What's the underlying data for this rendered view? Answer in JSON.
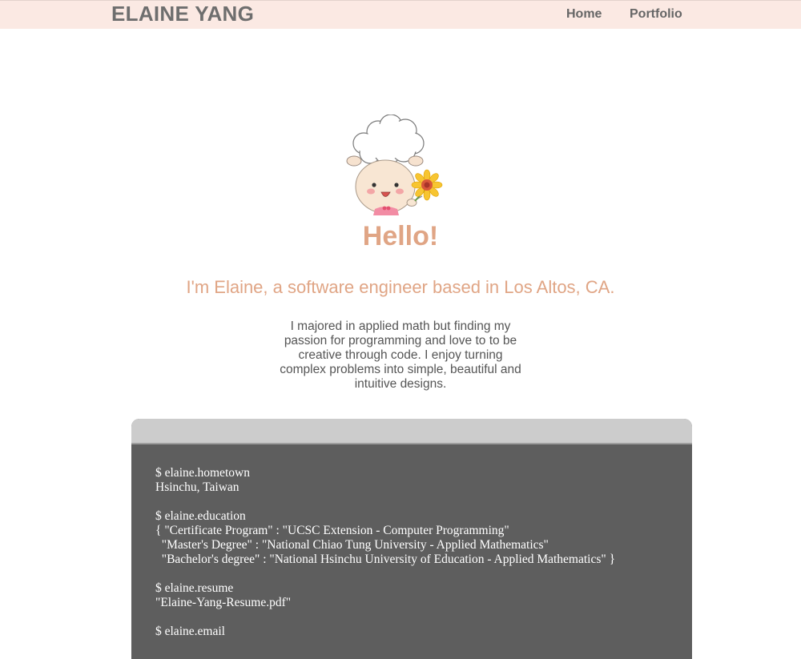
{
  "nav": {
    "brand": "ELAINE YANG",
    "links": [
      {
        "label": "Home"
      },
      {
        "label": "Portfolio"
      }
    ]
  },
  "hero": {
    "greeting": "Hello!",
    "tagline": "I'm Elaine, a software engineer based in Los Altos, CA.",
    "bio": "I majored in applied math but finding my passion for programming and love to to be creative through code. I enjoy turning complex problems into simple, beautiful and intuitive designs."
  },
  "terminal": {
    "blocks": [
      {
        "command": "$ elaine.hometown",
        "output": [
          "Hsinchu, Taiwan"
        ]
      },
      {
        "command": "$ elaine.education",
        "output": [
          "{ \"Certificate Program\" : \"UCSC Extension - Computer Programming\"",
          "  \"Master's Degree\" : \"National Chiao Tung University - Applied Mathematics\"",
          "  \"Bachelor's degree\" : \"National Hsinchu University of Education - Applied Mathematics\" }"
        ]
      },
      {
        "command": "$ elaine.resume",
        "output": [
          "\"Elaine-Yang-Resume.pdf\""
        ]
      },
      {
        "command": "$ elaine.email",
        "output": []
      }
    ]
  },
  "colors": {
    "nav_background": "#fbe9e3",
    "accent": "#e0a585",
    "terminal_background": "#5e5e5e",
    "terminal_bar": "#cccccc"
  },
  "icons": {
    "avatar": "chef-sheep-with-sunflower-illustration"
  }
}
